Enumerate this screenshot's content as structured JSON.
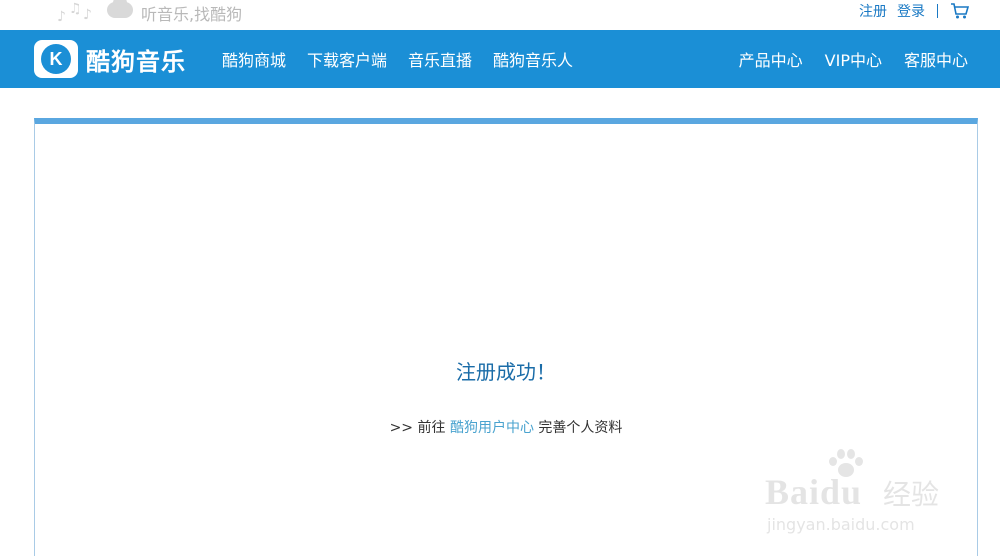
{
  "top": {
    "slogan": "听音乐,找酷狗",
    "links": {
      "register": "注册",
      "login": "登录"
    }
  },
  "nav": {
    "logo_text": "酷狗音乐",
    "logo_letter": "K",
    "left": [
      "酷狗商城",
      "下载客户端",
      "音乐直播",
      "酷狗音乐人"
    ],
    "right": [
      "产品中心",
      "VIP中心",
      "客服中心"
    ]
  },
  "main": {
    "success_message": "注册成功！",
    "next_prefix": ">> 前往",
    "next_link": "酷狗用户中心",
    "next_suffix": "完善个人资料"
  },
  "watermark": {
    "brand": "Baidu",
    "brand_cn": "经验",
    "url": "jingyan.baidu.com"
  },
  "colors": {
    "nav_bg": "#1b8fd6",
    "link": "#1a79c4",
    "success_text": "#1a6ca8",
    "panel_border": "#5aa7e0"
  }
}
